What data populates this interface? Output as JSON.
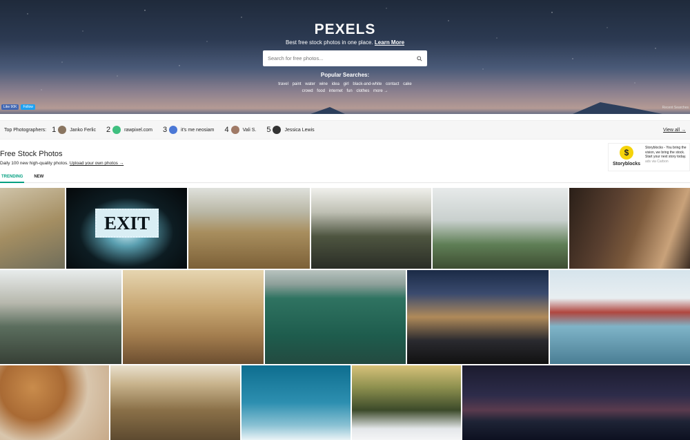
{
  "hero": {
    "logo": "PEXELS",
    "tagline": "Best free stock photos in one place.",
    "learn_more": "Learn More",
    "search_placeholder": "Search for free photos...",
    "popular_title": "Popular Searches:",
    "tags_row1": [
      "travel",
      "paint",
      "water",
      "wine",
      "idea",
      "girl",
      "black-and-white",
      "contact",
      "cake"
    ],
    "tags_row2": [
      "crowd",
      "food",
      "internet",
      "fun",
      "clothes",
      "more →"
    ],
    "fb_like": "Like 90K",
    "tw_follow": "Follow",
    "recent_searches": "Recent Searches"
  },
  "top_photographers": {
    "label": "Top Photographers:",
    "items": [
      {
        "rank": "1",
        "name": "Janko Ferlic",
        "avatar_color": "#8a7560"
      },
      {
        "rank": "2",
        "name": "rawpixel.com",
        "avatar_color": "#3fbf7f"
      },
      {
        "rank": "3",
        "name": "it's me neosiam",
        "avatar_color": "#4b78d6"
      },
      {
        "rank": "4",
        "name": "Vali S.",
        "avatar_color": "#a07a66"
      },
      {
        "rank": "5",
        "name": "Jessica Lewis",
        "avatar_color": "#333333"
      }
    ],
    "view_all": "View all →"
  },
  "section": {
    "title": "Free Stock Photos",
    "subtitle": "Daily 100 new high-quality photos.",
    "upload_link": "Upload your own photos →"
  },
  "ad": {
    "brand": "Storyblocks",
    "text": "Storyblocks - You bring the vision, we bring the stock. Start your next story today.",
    "via": "ads via Carbon"
  },
  "tabs": [
    "TRENDING",
    "NEW"
  ],
  "photos": [
    {
      "name": "photo-map-in-field",
      "bg": "linear-gradient(160deg,#cfc3a8,#a48e62 50%,#6f6d5a)"
    },
    {
      "name": "photo-exit-sign",
      "bg": "radial-gradient(ellipse at 50% 55%,#c9e8f0 0%,#5a9fb0 22%,#0d1c22 55%,#05080a 100%)"
    },
    {
      "name": "photo-woman-wheat-field",
      "bg": "linear-gradient(180deg,#dfe1dc 0%,#b9b7a5 30%,#a88e5e 55%,#7c6037 100%)"
    },
    {
      "name": "photo-couple-cliff-selfie",
      "bg": "linear-gradient(180deg,#f0f0ec 0%,#bfc0b4 30%,#4e5540 60%,#2a2d26 100%)"
    },
    {
      "name": "photo-raised-arms-hills",
      "bg": "linear-gradient(180deg,#e7eaea 0%,#c9d0ce 40%,#5f7f56 70%,#3d4c31 100%)"
    },
    {
      "name": "photo-men-talking",
      "bg": "linear-gradient(110deg,#2a1f18 0%,#5a4030 35%,#7c5a3c 55%,#c9a27a 80%,#3b2c22 100%)"
    },
    {
      "name": "photo-couple-lake-cliffs",
      "bg": "linear-gradient(180deg,#e8ecec 0%,#b7b8ad 35%,#5b6e5e 60%,#374036 100%)"
    },
    {
      "name": "photo-girl-camera-sunset",
      "bg": "linear-gradient(180deg,#e6d5b0 0%,#c7a672 40%,#a37d4e 70%,#6c4e30 100%)"
    },
    {
      "name": "photo-green-sea",
      "bg": "linear-gradient(180deg,#b8c3bf 0%,#8ea09a 15%,#2f7361 30%,#1e5c4d 70%,#234a40 100%)"
    },
    {
      "name": "photo-city-street-lights",
      "bg": "linear-gradient(180deg,#1b2b46 0%,#3a4a6e 25%,#b08a5a 50%,#2a2a2f 75%,#111 100%)"
    },
    {
      "name": "photo-train-frozen-lake",
      "bg": "linear-gradient(180deg,#d6e4ec 0%,#e8eef1 30%,#b0463f 45%,#7fb4c8 60%,#4a7e94 100%)"
    },
    {
      "name": "photo-cookies-tray",
      "bg": "radial-gradient(circle at 30% 30%,#c98c4c 0%,#a96a34 35%,#d9c6ad 60%,#c7a988 100%)"
    },
    {
      "name": "photo-forest-aerial",
      "bg": "linear-gradient(180deg,#e9e0cd 0%,#c8b38c 25%,#8a7048 60%,#5d4a30 100%)"
    },
    {
      "name": "photo-kite-snow",
      "bg": "linear-gradient(180deg,#0e6e8f 0%,#2d8fb0 50%,#89c1d3 80%,#e9f3f6 100%)"
    },
    {
      "name": "photo-snow-forest-sun",
      "bg": "linear-gradient(180deg,#d7c27a 0%,#8c8f4e 30%,#3c4a2a 60%,#e4e7ea 85%,#f4f5f6 100%)"
    },
    {
      "name": "photo-city-night-skyline",
      "bg": "linear-gradient(180deg,#1b1b2e 0%,#2d2c4a 40%,#5a3b4e 60%,#1e2436 75%,#0d1020 100%)"
    }
  ]
}
